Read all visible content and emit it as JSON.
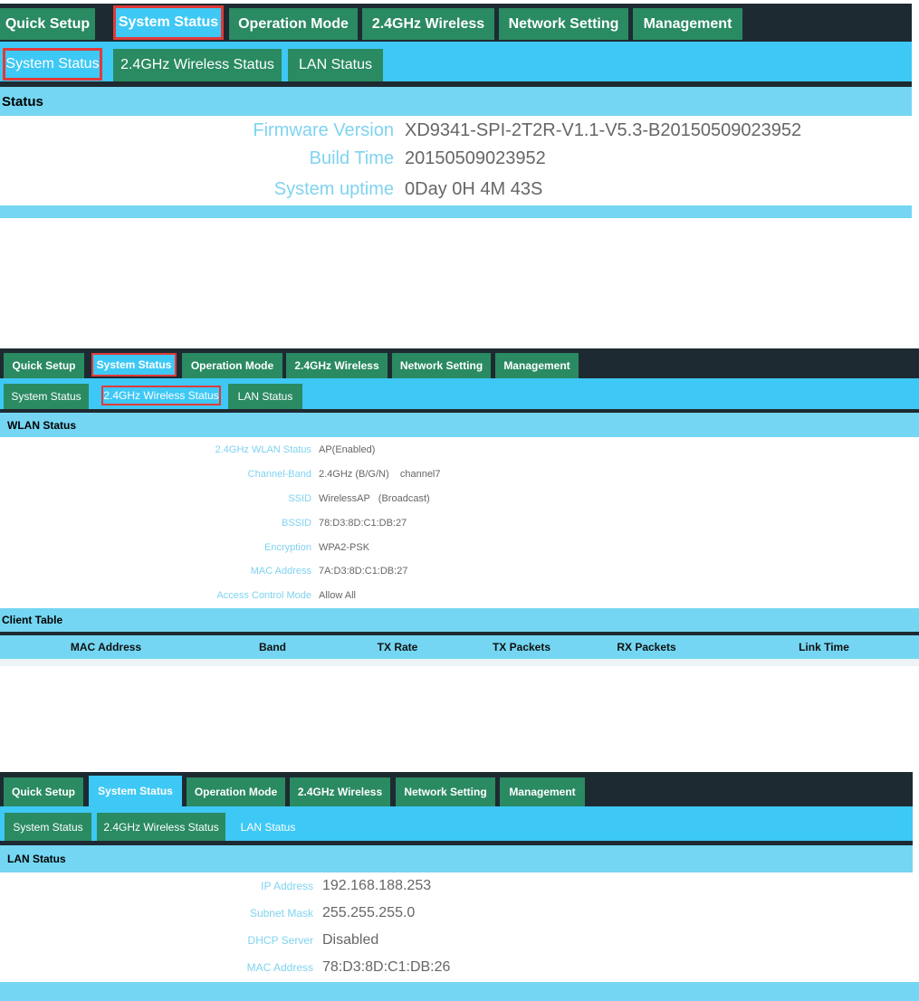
{
  "panels": [
    {
      "tabs": [
        "Quick Setup",
        "System Status",
        "Operation Mode",
        "2.4GHz Wireless",
        "Network Setting",
        "Management"
      ],
      "subtabs": [
        "System Status",
        "2.4GHz Wireless Status",
        "LAN Status"
      ],
      "section_title": "Status",
      "fields": [
        {
          "label": "Firmware Version",
          "value": "XD9341-SPI-2T2R-V1.1-V5.3-B20150509023952"
        },
        {
          "label": "Build Time",
          "value": "20150509023952"
        },
        {
          "label": "System uptime",
          "value": "0Day 0H 4M 43S"
        }
      ]
    },
    {
      "tabs": [
        "Quick Setup",
        "System Status",
        "Operation Mode",
        "2.4GHz Wireless",
        "Network Setting",
        "Management"
      ],
      "subtabs": [
        "System Status",
        "2.4GHz Wireless Status",
        "LAN Status"
      ],
      "section_title": "WLAN Status",
      "fields": [
        {
          "label": "2.4GHz WLAN Status",
          "value": "AP(Enabled)"
        },
        {
          "label": "Channel-Band",
          "value": "2.4GHz (B/G/N)    channel7"
        },
        {
          "label": "SSID",
          "value": "WirelessAP   (Broadcast)"
        },
        {
          "label": "BSSID",
          "value": "78:D3:8D:C1:DB:27"
        },
        {
          "label": "Encryption",
          "value": "WPA2-PSK"
        },
        {
          "label": "MAC Address",
          "value": "7A:D3:8D:C1:DB:27"
        },
        {
          "label": "Access Control Mode",
          "value": "Allow All"
        }
      ],
      "client_table": {
        "title": "Client Table",
        "columns": [
          "MAC Address",
          "Band",
          "TX Rate",
          "TX Packets",
          "RX Packets",
          "Link Time"
        ]
      }
    },
    {
      "tabs": [
        "Quick Setup",
        "System Status",
        "Operation Mode",
        "2.4GHz Wireless",
        "Network Setting",
        "Management"
      ],
      "subtabs": [
        "System Status",
        "2.4GHz Wireless Status",
        "LAN Status"
      ],
      "section_title": "LAN Status",
      "fields": [
        {
          "label": "IP Address",
          "value": "192.168.188.253"
        },
        {
          "label": "Subnet Mask",
          "value": "255.255.255.0"
        },
        {
          "label": "DHCP Server",
          "value": "Disabled"
        },
        {
          "label": "MAC Address",
          "value": "78:D3:8D:C1:DB:26"
        }
      ]
    }
  ],
  "colors": {
    "nav_bg": "#1e2a31",
    "tab_green": "#2a8a62",
    "accent_blue": "#3ec8f5",
    "section_blue": "#74d6f2",
    "label_blue": "#7fd3f0",
    "value_gray": "#666666",
    "highlight_red": "#e03a3a"
  }
}
